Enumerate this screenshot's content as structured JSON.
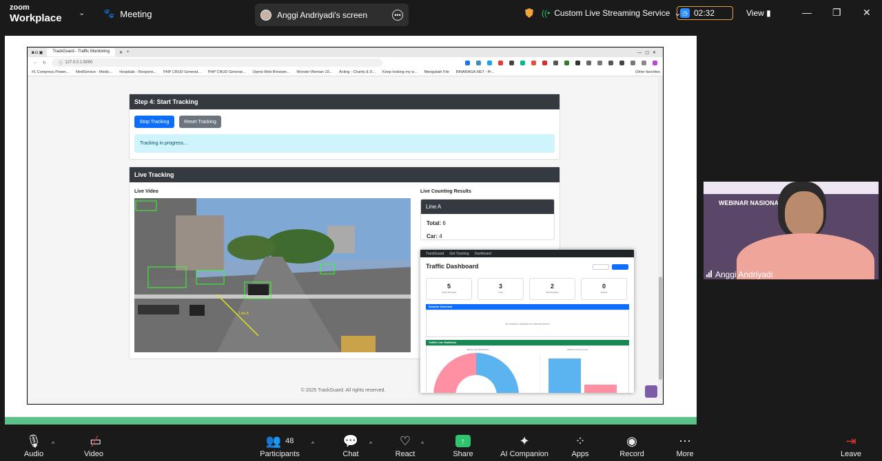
{
  "zoom": {
    "brand_top": "zoom",
    "brand_bottom": "Workplace",
    "meeting_label": "Meeting",
    "screen_label": "Anggi Andriyadi's screen",
    "live_label": "Custom Live Streaming Service",
    "timer": "02:32",
    "view_label": "View"
  },
  "browser": {
    "tab_title": "TrackGuard - Traffic Monitoring",
    "url": "127.0.0.1:5000",
    "bookmarks": [
      "#1 Compress Power...",
      "MedService - Medic...",
      "Hospitals - Respons...",
      "PHP CRUD Generat...",
      "PHP CRUD Generat...",
      "Opera Web Browser...",
      "Wonder Woman 19...",
      "Acting - Charity & D...",
      "Keep looking my w...",
      "Mengubah File",
      "BINARAGA.NET - Pr...",
      "Other favorites"
    ]
  },
  "app": {
    "step4_title": "Step 4: Start Tracking",
    "stop_btn": "Stop Tracking",
    "reset_btn": "Reset Tracking",
    "progress": "Tracking in progress...",
    "live_title": "Live Tracking",
    "live_video": "Live Video",
    "counting": "Live Counting Results",
    "line_a": "Line A",
    "total_label": "Total:",
    "total_val": "6",
    "car_label": "Car:",
    "car_val": "4",
    "video_line": "Line A",
    "footer": "© 2025 TrackGuard. All rights reserved."
  },
  "dashboard": {
    "nav": [
      "TrackGuard",
      "Get Tracking",
      "Dashboard"
    ],
    "title": "Traffic Dashboard",
    "stats": [
      {
        "value": "5",
        "label": "Total Vehicles"
      },
      {
        "value": "3",
        "label": "Cars"
      },
      {
        "value": "2",
        "label": "Motorcycles"
      },
      {
        "value": "0",
        "label": "Buses"
      }
    ],
    "session_title": "Session Overview",
    "session_empty": "No sessions available for selected period",
    "stats_title": "Traffic Line Statistics",
    "chart_left": "Vehicle Type Distribution",
    "chart_right": "Vehicle Counts by Line"
  },
  "participant": {
    "name": "Anggi Andriyadi",
    "bg_title": "WEBINAR NASIONAL"
  },
  "toolbar": {
    "audio": "Audio",
    "video": "Video",
    "participants": "Participants",
    "participants_count": "48",
    "chat": "Chat",
    "react": "React",
    "share": "Share",
    "ai": "AI Companion",
    "apps": "Apps",
    "record": "Record",
    "more": "More",
    "leave": "Leave"
  }
}
